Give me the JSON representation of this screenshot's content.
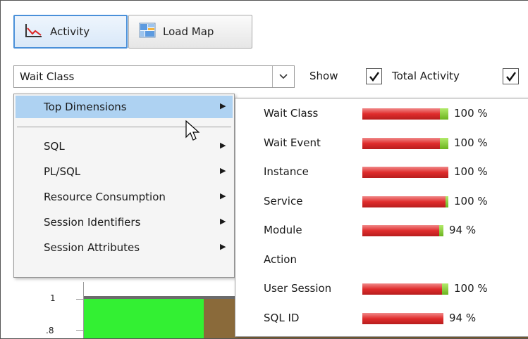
{
  "tabs": {
    "activity_label": "Activity",
    "loadmap_label": "Load Map"
  },
  "filter": {
    "selected": "Wait Class",
    "show_label": "Show",
    "total_activity_label": "Total Activity",
    "total_activity_checked": true,
    "second_checked": true
  },
  "menu": {
    "items": [
      {
        "label": "Top Dimensions",
        "selected": true
      },
      {
        "label": "SQL"
      },
      {
        "label": "PL/SQL"
      },
      {
        "label": "Resource Consumption"
      },
      {
        "label": "Session Identifiers"
      },
      {
        "label": "Session Attributes"
      }
    ]
  },
  "dimensions": [
    {
      "name": "Wait Class",
      "pct_label": "100 %",
      "red": 0.9,
      "green": 0.1
    },
    {
      "name": "Wait Event",
      "pct_label": "100 %",
      "red": 0.9,
      "green": 0.1
    },
    {
      "name": "Instance",
      "pct_label": "100 %",
      "red": 1.0,
      "green": 0.0
    },
    {
      "name": "Service",
      "pct_label": "100 %",
      "red": 0.97,
      "green": 0.03
    },
    {
      "name": "Module",
      "pct_label": "94 %",
      "red": 0.89,
      "green": 0.05
    },
    {
      "name": "Action",
      "pct_label": "",
      "red": 0,
      "green": 0
    },
    {
      "name": "User Session",
      "pct_label": "100 %",
      "red": 0.93,
      "green": 0.07
    },
    {
      "name": "SQL ID",
      "pct_label": "94 %",
      "red": 0.94,
      "green": 0.0
    }
  ],
  "chart": {
    "y_ticks": [
      "1",
      ".8"
    ],
    "colors": {
      "series1": "#33f033",
      "series2": "#8a6a3a",
      "bar_red": "#e02c2c",
      "bar_green": "#6bb31f"
    }
  },
  "icons": {
    "activity": "line-chart-icon",
    "loadmap": "load-map-icon",
    "submenu": "triangle-right-icon",
    "dropdown": "chevron-down-icon"
  }
}
